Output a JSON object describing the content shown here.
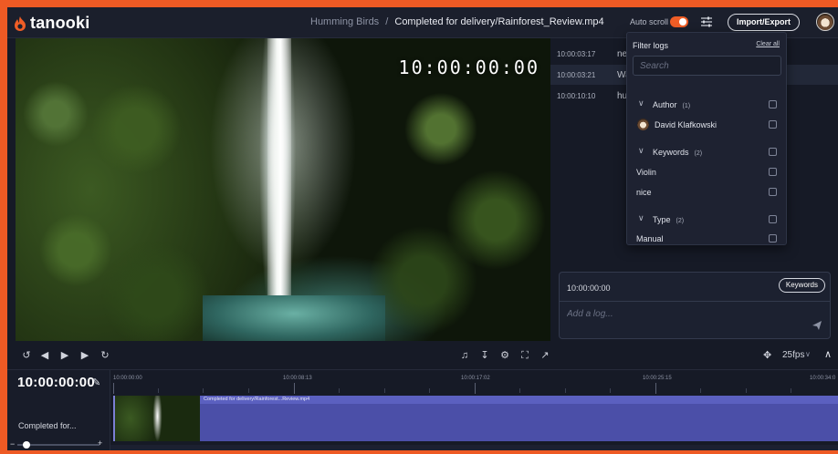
{
  "app": {
    "name": "tanooki"
  },
  "breadcrumb": {
    "parent": "Humming Birds",
    "separator": "/",
    "current": "Completed for delivery/Rainforest_Review.mp4"
  },
  "header": {
    "autoscroll_label": "Auto scroll",
    "autoscroll_on": true,
    "import_export_label": "Import/Export"
  },
  "video": {
    "timecode_overlay": "10:00:00:00"
  },
  "logs": [
    {
      "time": "10:00:03:17",
      "text": "nev"
    },
    {
      "time": "10:00:03:21",
      "text": "Wa"
    },
    {
      "time": "10:00:10:10",
      "text": "hur"
    }
  ],
  "filter": {
    "title": "Filter logs",
    "clear_all": "Clear all",
    "search_placeholder": "Search",
    "groups": [
      {
        "label": "Author",
        "count": "(1)",
        "items": [
          "David Klafkowski"
        ]
      },
      {
        "label": "Keywords",
        "count": "(2)",
        "items": [
          "Violin",
          "nice"
        ]
      },
      {
        "label": "Type",
        "count": "(2)",
        "items": [
          "Manual"
        ]
      }
    ]
  },
  "composer": {
    "timecode": "10:00:00:00",
    "keywords_button": "Keywords",
    "placeholder": "Add a log..."
  },
  "transport": {
    "fps_label": "25fps"
  },
  "timeline": {
    "current_time": "10:00:00:00",
    "track_name": "Completed for...",
    "ruler_labels": [
      "10:00:00:00",
      "10:00:08:13",
      "10:00:17:02",
      "10:00:25:15",
      "10:00:34:0"
    ],
    "clip_name": "Completed for delivery/Rainforest...Review.mp4"
  },
  "colors": {
    "accent": "#ef5d26",
    "clip": "#4b4fa8",
    "background": "#161a26"
  }
}
